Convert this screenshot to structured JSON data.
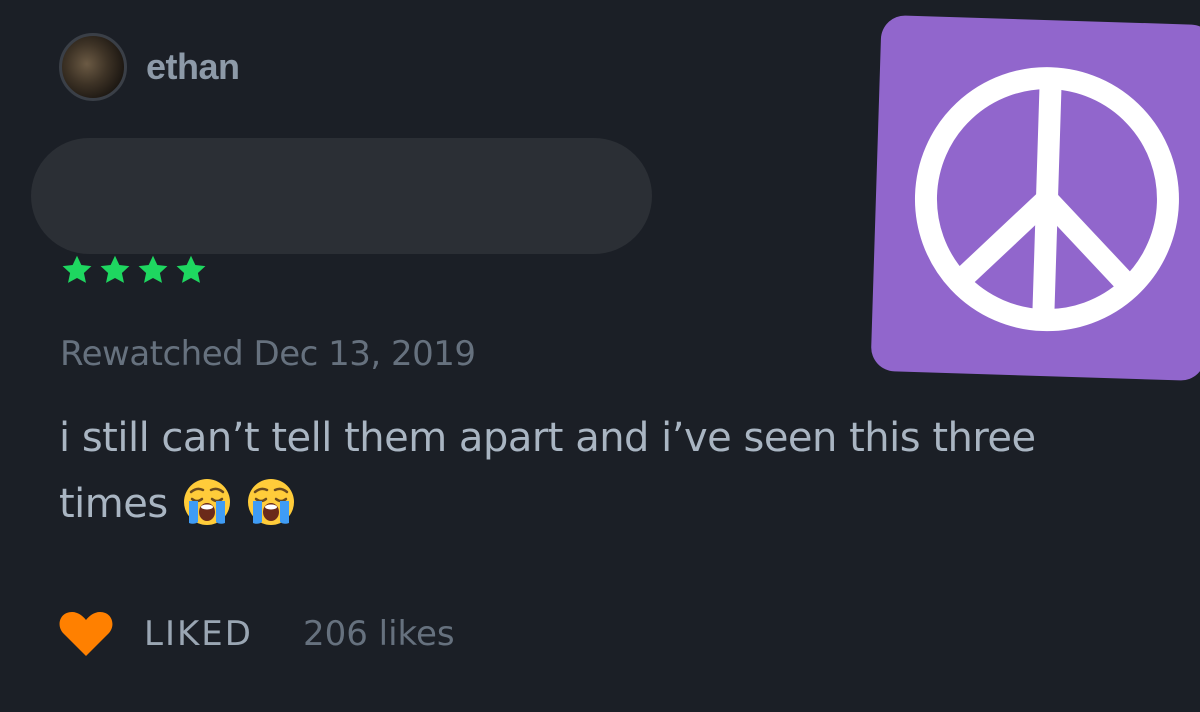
{
  "review": {
    "username": "ethan",
    "rating_stars": 4,
    "rewatch_label": "Rewatched Dec 13, 2019",
    "text": "i still can’t tell them apart and i’ve seen this three times",
    "text_emoji": "loudly-crying-face-emoji",
    "text_emoji_count": 2
  },
  "actions": {
    "liked_label": "LIKED",
    "likes_count": "206 likes"
  },
  "icons": {
    "avatar": "avatar",
    "star": "star-icon",
    "heart": "heart-icon",
    "poster": "peace-sign-icon"
  },
  "colors": {
    "background": "#1b1f26",
    "star": "#1ed760",
    "heart": "#ff8000",
    "poster_bg": "#9166cc",
    "username": "#8d9aa8"
  }
}
